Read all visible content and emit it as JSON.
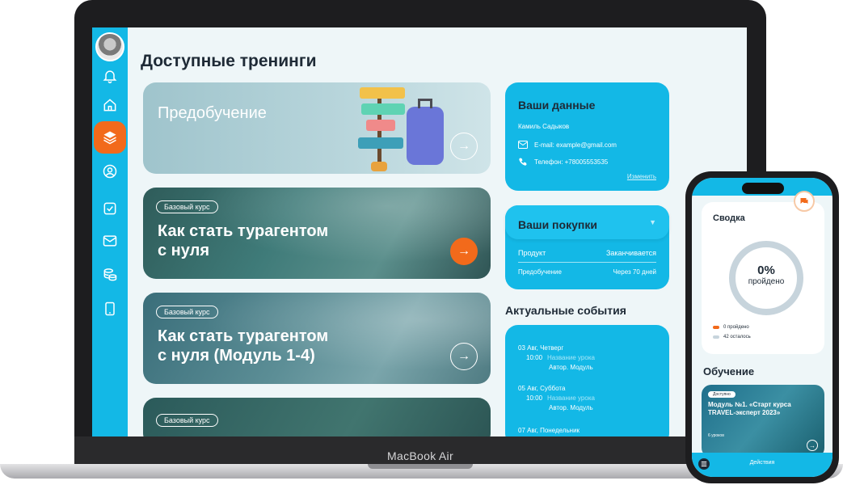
{
  "laptop": {
    "brand": "MacBook Air",
    "page_title": "Доступные тренинги",
    "courses": [
      {
        "badge": "",
        "title_line1": "Предобучение",
        "title_line2": ""
      },
      {
        "badge": "Базовый курс",
        "title_line1": "Как стать турагентом",
        "title_line2": "с нуля"
      },
      {
        "badge": "Базовый курс",
        "title_line1": "Как стать турагентом",
        "title_line2": "с нуля (Модуль 1-4)"
      },
      {
        "badge": "Базовый курс",
        "title_line1": "",
        "title_line2": ""
      }
    ],
    "arrow_glyph": "→",
    "user_data": {
      "title": "Ваши данные",
      "name": "Камиль Садыков",
      "email": "E-mail: example@gmail.com",
      "phone": "Телефон: +78005553535",
      "edit_link": "Изменить"
    },
    "purchases": {
      "title": "Ваши покупки",
      "col_product": "Продукт",
      "col_ends": "Заканчивается",
      "rows": [
        {
          "product": "Предобучение",
          "ends": "Через 70 дней"
        }
      ]
    },
    "events": {
      "title": "Актуальные события",
      "items": [
        {
          "date": "03 Авг, Четверг",
          "time": "10:00",
          "lesson": "Название урока",
          "author": "Автор. Модуль"
        },
        {
          "date": "05 Авг, Суббота",
          "time": "10:00",
          "lesson": "Название урока",
          "author": "Автор. Модуль"
        },
        {
          "date": "07 Авг, Понедельник",
          "time": "",
          "lesson": "",
          "author": ""
        }
      ]
    },
    "colors": {
      "accent": "#13b8e6",
      "orange": "#f26a1b",
      "dark": "#1e2a36"
    }
  },
  "phone": {
    "summary_title": "Сводка",
    "progress_percent": "0%",
    "progress_label": "пройдено",
    "legend_done": "0 пройдено",
    "legend_left": "42 осталось",
    "learning_title": "Обучение",
    "course_badge": "Доступно",
    "course_title": "Модуль №1. «Старт курса TRAVEL-эксперт 2023»",
    "course_lessons": "6 уроков",
    "bottom_label": "Действия"
  }
}
